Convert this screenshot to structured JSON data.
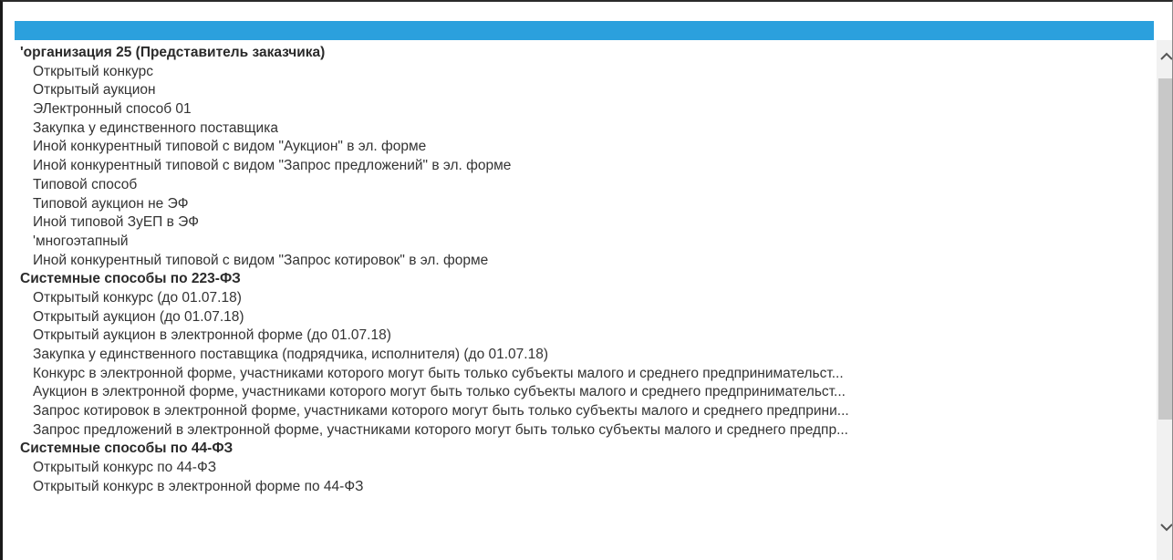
{
  "list": {
    "items": [
      {
        "type": "group",
        "label": "'организация 25 (Представитель заказчика)"
      },
      {
        "type": "item",
        "label": "Открытый конкурс"
      },
      {
        "type": "item",
        "label": "Открытый аукцион"
      },
      {
        "type": "item",
        "label": "ЭЛектронный способ 01"
      },
      {
        "type": "item",
        "label": "Закупка у единственного поставщика"
      },
      {
        "type": "item",
        "label": "Иной конкурентный типовой с видом \"Аукцион\" в эл. форме"
      },
      {
        "type": "item",
        "label": "Иной конкурентный типовой с видом \"Запрос предложений\" в эл. форме"
      },
      {
        "type": "item",
        "label": "Типовой способ"
      },
      {
        "type": "item",
        "label": "Типовой аукцион не ЭФ"
      },
      {
        "type": "item",
        "label": "Иной типовой ЗуЕП в ЭФ"
      },
      {
        "type": "item",
        "label": "'многоэтапный"
      },
      {
        "type": "item",
        "label": "Иной конкурентный типовой с видом \"Запрос котировок\" в эл. форме"
      },
      {
        "type": "group",
        "label": "Системные способы по 223-ФЗ"
      },
      {
        "type": "item",
        "label": "Открытый конкурс (до 01.07.18)"
      },
      {
        "type": "item",
        "label": "Открытый аукцион (до 01.07.18)"
      },
      {
        "type": "item",
        "label": "Открытый аукцион в электронной форме (до 01.07.18)"
      },
      {
        "type": "item",
        "label": "Закупка у единственного поставщика (подрядчика, исполнителя) (до 01.07.18)"
      },
      {
        "type": "item",
        "label": "Конкурс в электронной форме, участниками которого могут быть только субъекты малого и среднего предпринимательст..."
      },
      {
        "type": "item",
        "label": "Аукцион в электронной форме, участниками которого могут быть только субъекты малого и среднего предпринимательст..."
      },
      {
        "type": "item",
        "label": "Запрос котировок в электронной форме, участниками которого могут быть только субъекты малого и среднего предприни..."
      },
      {
        "type": "item",
        "label": "Запрос предложений в электронной форме, участниками которого могут быть только субъекты малого и среднего предпр..."
      },
      {
        "type": "group",
        "label": "Системные способы по 44-ФЗ"
      },
      {
        "type": "item",
        "label": "Открытый конкурс по 44-ФЗ"
      },
      {
        "type": "item",
        "label": "Открытый конкурс в электронной форме по 44-ФЗ"
      }
    ]
  },
  "scrollbar": {
    "up_icon": "chevron-up-icon",
    "down_icon": "chevron-down-icon",
    "position_fraction": 0.0
  },
  "colors": {
    "selected": "#2ba0dd",
    "text": "#333333"
  }
}
